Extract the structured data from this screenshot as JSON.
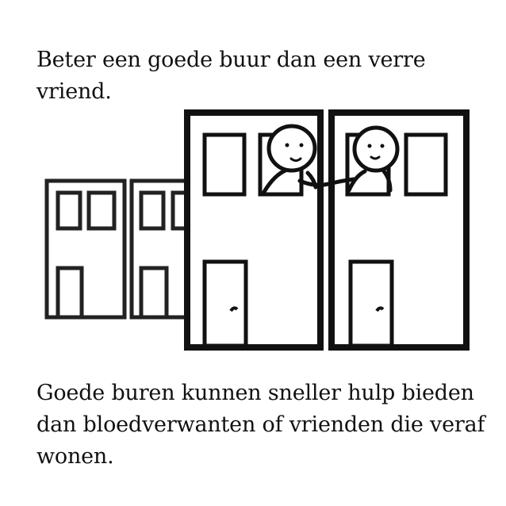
{
  "proverb": "Beter een goede buur dan een verre vriend.",
  "explanation": "Goede buren kunnen sneller hulp bieden dan bloedverwanten of vrienden die veraf wonen.",
  "colors": {
    "ink": "#111111",
    "far_house": "#222222",
    "background": "#ffffff"
  },
  "illustration": {
    "icons": [
      "far-house-icon",
      "near-house-icon",
      "neighbor-icon",
      "handshake-icon"
    ]
  }
}
